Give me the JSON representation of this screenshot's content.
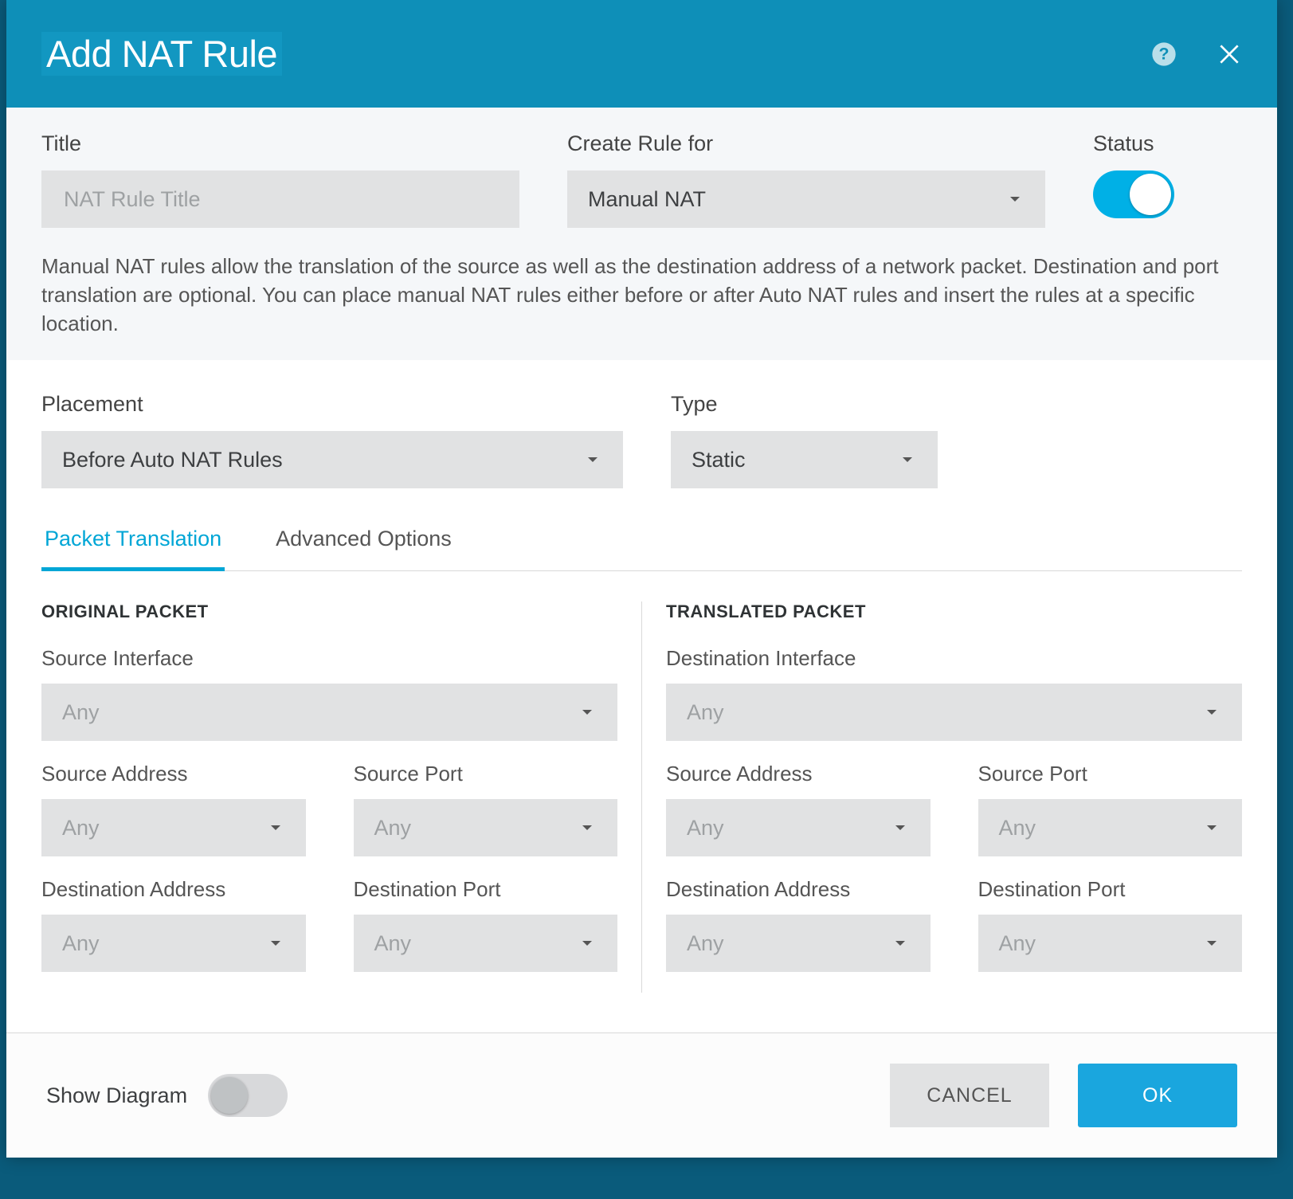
{
  "header": {
    "title": "Add NAT Rule"
  },
  "upper": {
    "title_label": "Title",
    "title_placeholder": "NAT Rule Title",
    "rulefor_label": "Create Rule for",
    "rulefor_value": "Manual NAT",
    "status_label": "Status",
    "description": "Manual NAT rules allow the translation of the source as well as the destination address of a network packet. Destination and port translation are optional. You can place manual NAT rules either before or after Auto NAT rules and insert the rules at a specific location."
  },
  "lower": {
    "placement_label": "Placement",
    "placement_value": "Before Auto NAT Rules",
    "type_label": "Type",
    "type_value": "Static"
  },
  "tabs": {
    "packet": "Packet Translation",
    "advanced": "Advanced Options"
  },
  "packet": {
    "original_heading": "ORIGINAL PACKET",
    "translated_heading": "TRANSLATED PACKET",
    "src_iface_label": "Source Interface",
    "dst_iface_label": "Destination Interface",
    "src_addr_label": "Source Address",
    "src_port_label": "Source Port",
    "dst_addr_label": "Destination Address",
    "dst_port_label": "Destination Port",
    "any": "Any"
  },
  "footer": {
    "show_diagram": "Show Diagram",
    "cancel": "CANCEL",
    "ok": "OK"
  }
}
